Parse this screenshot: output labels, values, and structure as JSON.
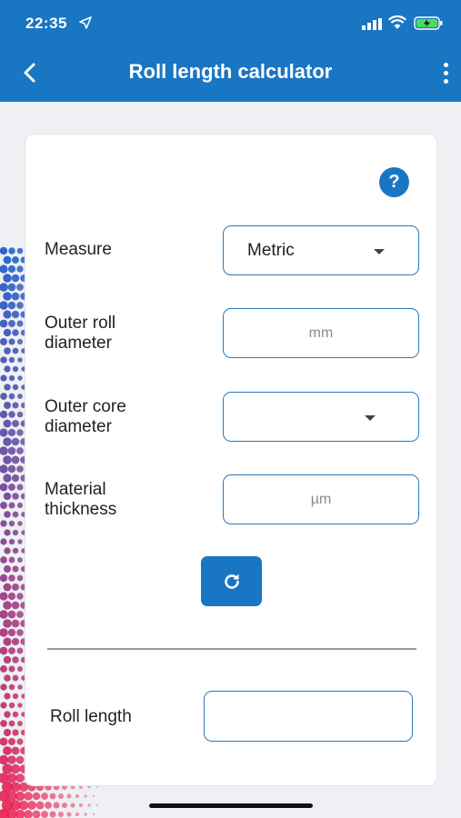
{
  "status_bar": {
    "time": "22:35"
  },
  "header": {
    "title": "Roll length calculator"
  },
  "form": {
    "help_label": "?",
    "measure": {
      "label": "Measure",
      "value": "Metric"
    },
    "outer_roll_diameter": {
      "label_line1": "Outer roll",
      "label_line2": "diameter",
      "placeholder": "mm"
    },
    "outer_core_diameter": {
      "label_line1": "Outer core",
      "label_line2": "diameter",
      "value": ""
    },
    "material_thickness": {
      "label_line1": "Material",
      "label_line2": "thickness",
      "placeholder": "µm"
    }
  },
  "result": {
    "label": "Roll length",
    "value": ""
  },
  "colors": {
    "primary": "#1976c3",
    "field_border": "#2a78be",
    "background": "#eef0f3"
  },
  "icons": [
    "location-arrow-icon",
    "signal-icon",
    "wifi-icon",
    "battery-charging-icon",
    "back-arrow-icon",
    "more-vertical-icon",
    "help-icon",
    "caret-down-icon",
    "refresh-icon"
  ]
}
